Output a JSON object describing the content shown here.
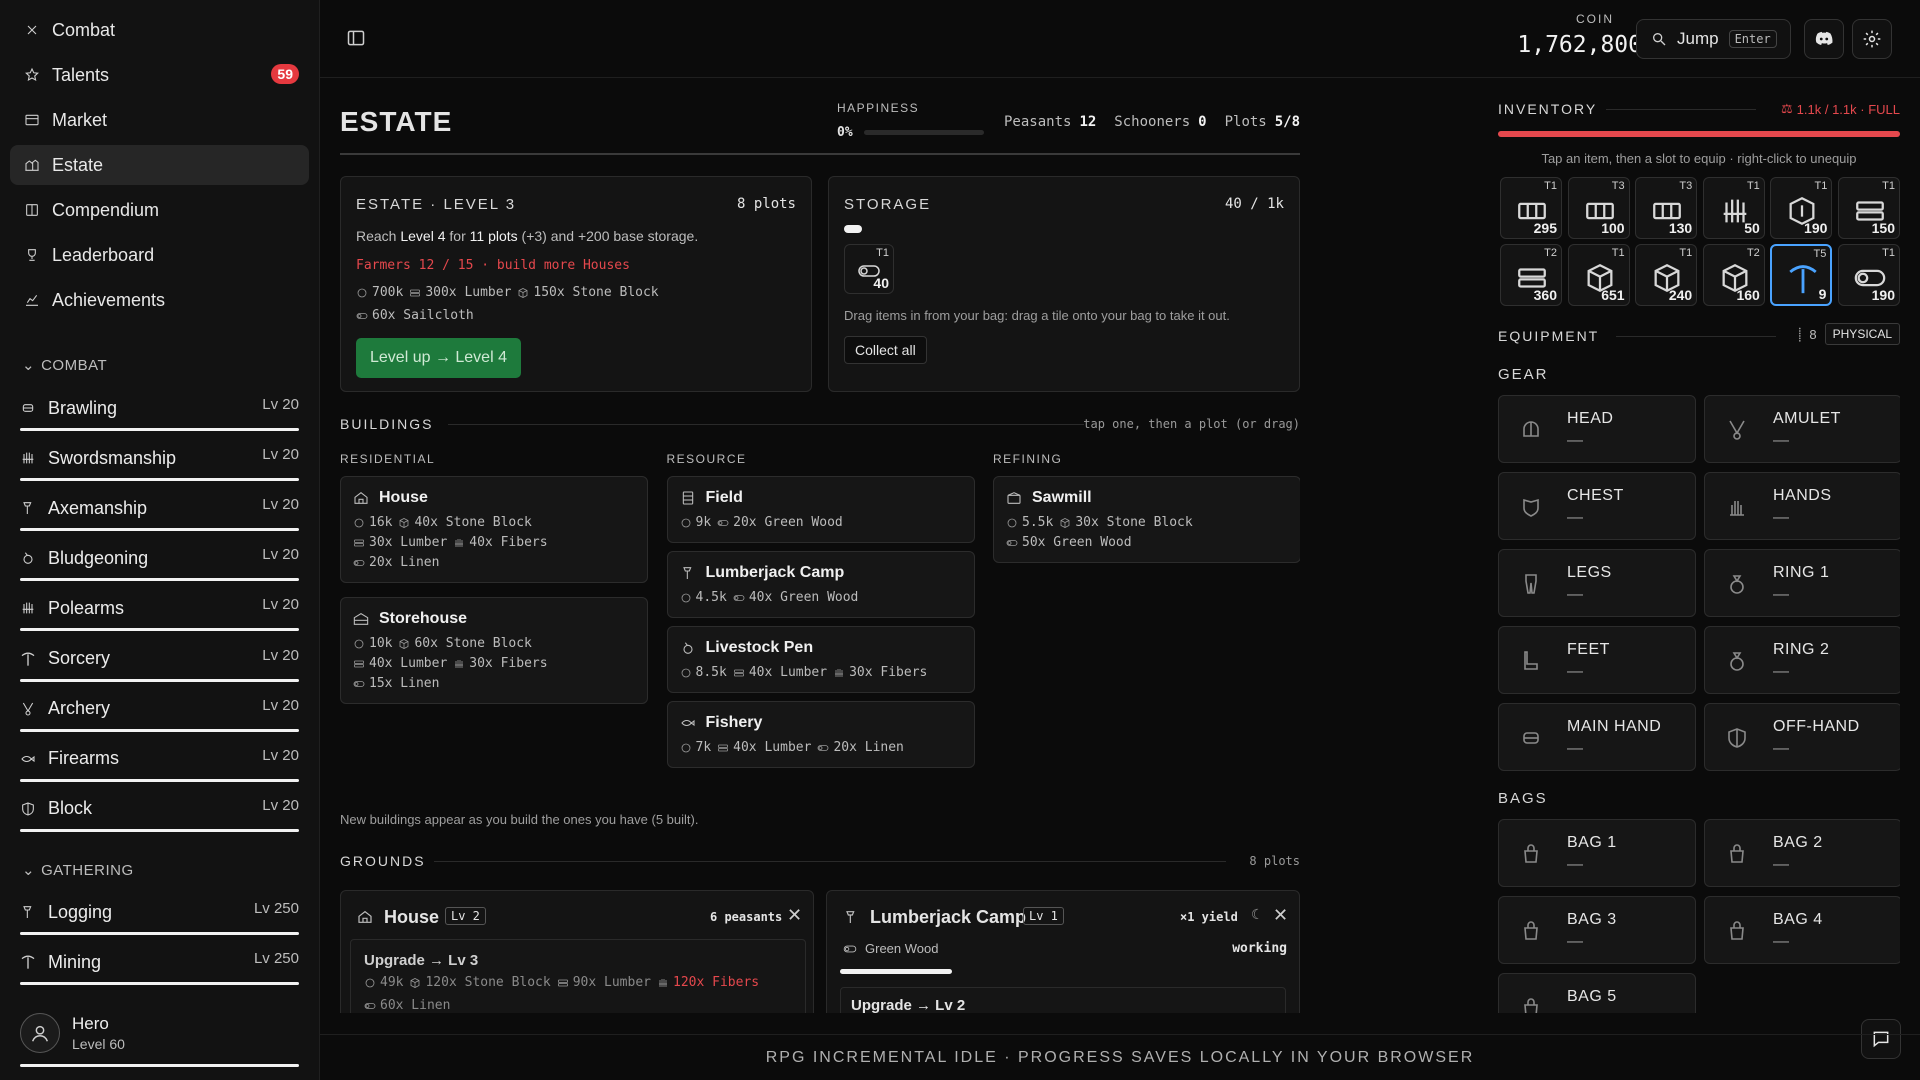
{
  "nav": [
    {
      "label": "Combat",
      "icon": "combat-icon"
    },
    {
      "label": "Talents",
      "icon": "star-icon",
      "badge": "59"
    },
    {
      "label": "Market",
      "icon": "market-icon"
    },
    {
      "label": "Estate",
      "icon": "estate-icon",
      "active": true
    },
    {
      "label": "Compendium",
      "icon": "book-icon"
    },
    {
      "label": "Leaderboard",
      "icon": "trophy-icon"
    },
    {
      "label": "Achievements",
      "icon": "chart-icon"
    }
  ],
  "combat_section": {
    "label": "COMBAT",
    "skills": [
      {
        "label": "Brawling",
        "lv": "Lv 20"
      },
      {
        "label": "Swordsmanship",
        "lv": "Lv 20"
      },
      {
        "label": "Axemanship",
        "lv": "Lv 20"
      },
      {
        "label": "Bludgeoning",
        "lv": "Lv 20"
      },
      {
        "label": "Polearms",
        "lv": "Lv 20"
      },
      {
        "label": "Sorcery",
        "lv": "Lv 20"
      },
      {
        "label": "Archery",
        "lv": "Lv 20"
      },
      {
        "label": "Firearms",
        "lv": "Lv 20"
      },
      {
        "label": "Block",
        "lv": "Lv 20"
      }
    ]
  },
  "gathering_section": {
    "label": "GATHERING",
    "skills": [
      {
        "label": "Logging",
        "lv": "Lv 250"
      },
      {
        "label": "Mining",
        "lv": "Lv 250"
      }
    ]
  },
  "profile": {
    "name": "Hero",
    "level": "Level 60"
  },
  "topbar": {
    "coin_label": "COIN",
    "coin_value": "1,762,800",
    "jump_label": "Jump",
    "jump_key": "Enter"
  },
  "estate": {
    "title": "ESTATE",
    "happiness_label": "HAPPINESS",
    "happiness_value": "0%",
    "happiness_fraction": 0,
    "stats": [
      {
        "label": "Peasants",
        "value": "12"
      },
      {
        "label": "Schooners",
        "value": "0"
      },
      {
        "label": "Plots",
        "value": "5/8"
      }
    ],
    "level_panel": {
      "title": "ESTATE · LEVEL 3",
      "plots": "8 plots",
      "reach_1": "Reach ",
      "reach_level": "Level 4",
      "reach_2": " for ",
      "reach_plots": "11 plots",
      "reach_3": " (+3) and +200 base storage.",
      "warning": "Farmers 12 / 15 · build more Houses",
      "costs_1": [
        "700k",
        "300x Lumber",
        "150x Stone Block"
      ],
      "costs_2": [
        "60x Sailcloth"
      ],
      "button": "Level up → Level 4"
    },
    "storage": {
      "title": "STORAGE",
      "count": "40 / 1k",
      "fill_fraction": 0.04,
      "item": {
        "tier": "T1",
        "count": "40"
      },
      "hint": "Drag items in from your bag: drag a tile onto your bag to take it out.",
      "collect": "Collect all"
    },
    "buildings": {
      "label": "BUILDINGS",
      "hint": "tap one, then a plot (or drag)",
      "columns": [
        {
          "label": "RESIDENTIAL",
          "cards": [
            {
              "name": "House",
              "icon": "house-icon",
              "lines": [
                [
                  "16k",
                  "40x Stone Block"
                ],
                [
                  "30x Lumber",
                  "40x Fibers"
                ],
                [
                  "20x Linen"
                ]
              ]
            },
            {
              "name": "Storehouse",
              "icon": "storehouse-icon",
              "lines": [
                [
                  "10k",
                  "60x Stone Block"
                ],
                [
                  "40x Lumber",
                  "30x Fibers"
                ],
                [
                  "15x Linen"
                ]
              ]
            }
          ]
        },
        {
          "label": "RESOURCE",
          "cards": [
            {
              "name": "Field",
              "icon": "field-icon",
              "lines": [
                [
                  "9k",
                  "20x Green Wood"
                ]
              ]
            },
            {
              "name": "Lumberjack Camp",
              "icon": "axe-icon",
              "lines": [
                [
                  "4.5k",
                  "40x Green Wood"
                ]
              ]
            },
            {
              "name": "Livestock Pen",
              "icon": "pen-icon",
              "lines": [
                [
                  "8.5k",
                  "40x Lumber",
                  "30x Fibers"
                ]
              ]
            },
            {
              "name": "Fishery",
              "icon": "fish-icon",
              "lines": [
                [
                  "7k",
                  "40x Lumber",
                  "20x Linen"
                ]
              ]
            }
          ]
        },
        {
          "label": "REFINING",
          "cards": [
            {
              "name": "Sawmill",
              "icon": "sawmill-icon",
              "lines": [
                [
                  "5.5k",
                  "30x Stone Block"
                ],
                [
                  "50x Green Wood"
                ]
              ]
            }
          ]
        }
      ],
      "footnote": "New buildings appear as you build the ones you have (5 built)."
    },
    "grounds": {
      "label": "GROUNDS",
      "plots": "8 plots",
      "house": {
        "name": "House",
        "lv": "Lv 2",
        "peasants": "6 peasants",
        "upgrade": "Upgrade → Lv 3",
        "costs_1": [
          "49k",
          "120x Stone Block",
          "90x Lumber",
          "120x Fibers"
        ],
        "costs_2": [
          "60x Linen"
        ]
      },
      "lumber": {
        "name": "Lumberjack Camp",
        "lv": "Lv 1",
        "yield": "×1 yield",
        "resource": "Green Wood",
        "status": "working",
        "progress": 0.25,
        "upgrade": "Upgrade → Lv 2"
      }
    }
  },
  "inventory": {
    "title": "INVENTORY",
    "capacity": "1.1k / 1.1k · FULL",
    "fill_fraction": 1,
    "hint": "Tap an item, then a slot to equip · right-click to unequip",
    "items": [
      {
        "tier": "T1",
        "count": "295",
        "icon": "plank-icon"
      },
      {
        "tier": "T3",
        "count": "100",
        "icon": "plank-icon"
      },
      {
        "tier": "T3",
        "count": "130",
        "icon": "plank-icon"
      },
      {
        "tier": "T1",
        "count": "50",
        "icon": "fiber-icon"
      },
      {
        "tier": "T1",
        "count": "190",
        "icon": "hide-icon"
      },
      {
        "tier": "T1",
        "count": "150",
        "icon": "lumber-icon"
      },
      {
        "tier": "T2",
        "count": "360",
        "icon": "lumber-icon"
      },
      {
        "tier": "T1",
        "count": "651",
        "icon": "stone-icon"
      },
      {
        "tier": "T1",
        "count": "240",
        "icon": "stone-icon"
      },
      {
        "tier": "T2",
        "count": "160",
        "icon": "stone-icon"
      },
      {
        "tier": "T5",
        "count": "9",
        "icon": "pickaxe-icon",
        "selected": true
      },
      {
        "tier": "T1",
        "count": "190",
        "icon": "log-icon"
      }
    ]
  },
  "equipment": {
    "title": "EQUIPMENT",
    "value": "8",
    "type": "PHYSICAL",
    "gear_label": "GEAR",
    "gear": [
      {
        "label": "HEAD",
        "value": "—",
        "icon": "helmet-icon"
      },
      {
        "label": "AMULET",
        "value": "—",
        "icon": "amulet-icon"
      },
      {
        "label": "CHEST",
        "value": "—",
        "icon": "chest-armor-icon"
      },
      {
        "label": "HANDS",
        "value": "—",
        "icon": "gloves-icon"
      },
      {
        "label": "LEGS",
        "value": "—",
        "icon": "legs-icon"
      },
      {
        "label": "RING 1",
        "value": "—",
        "icon": "ring-icon"
      },
      {
        "label": "FEET",
        "value": "—",
        "icon": "boot-icon"
      },
      {
        "label": "RING 2",
        "value": "—",
        "icon": "ring-icon"
      },
      {
        "label": "MAIN HAND",
        "value": "—",
        "icon": "fist-icon"
      },
      {
        "label": "OFF-HAND",
        "value": "—",
        "icon": "shield-icon"
      }
    ],
    "bags_label": "BAGS",
    "bags": [
      {
        "label": "BAG 1",
        "value": "—"
      },
      {
        "label": "BAG 2",
        "value": "—"
      },
      {
        "label": "BAG 3",
        "value": "—"
      },
      {
        "label": "BAG 4",
        "value": "—"
      },
      {
        "label": "BAG 5",
        "value": "—"
      }
    ]
  },
  "footer": "RPG INCREMENTAL IDLE · PROGRESS SAVES LOCALLY IN YOUR BROWSER"
}
